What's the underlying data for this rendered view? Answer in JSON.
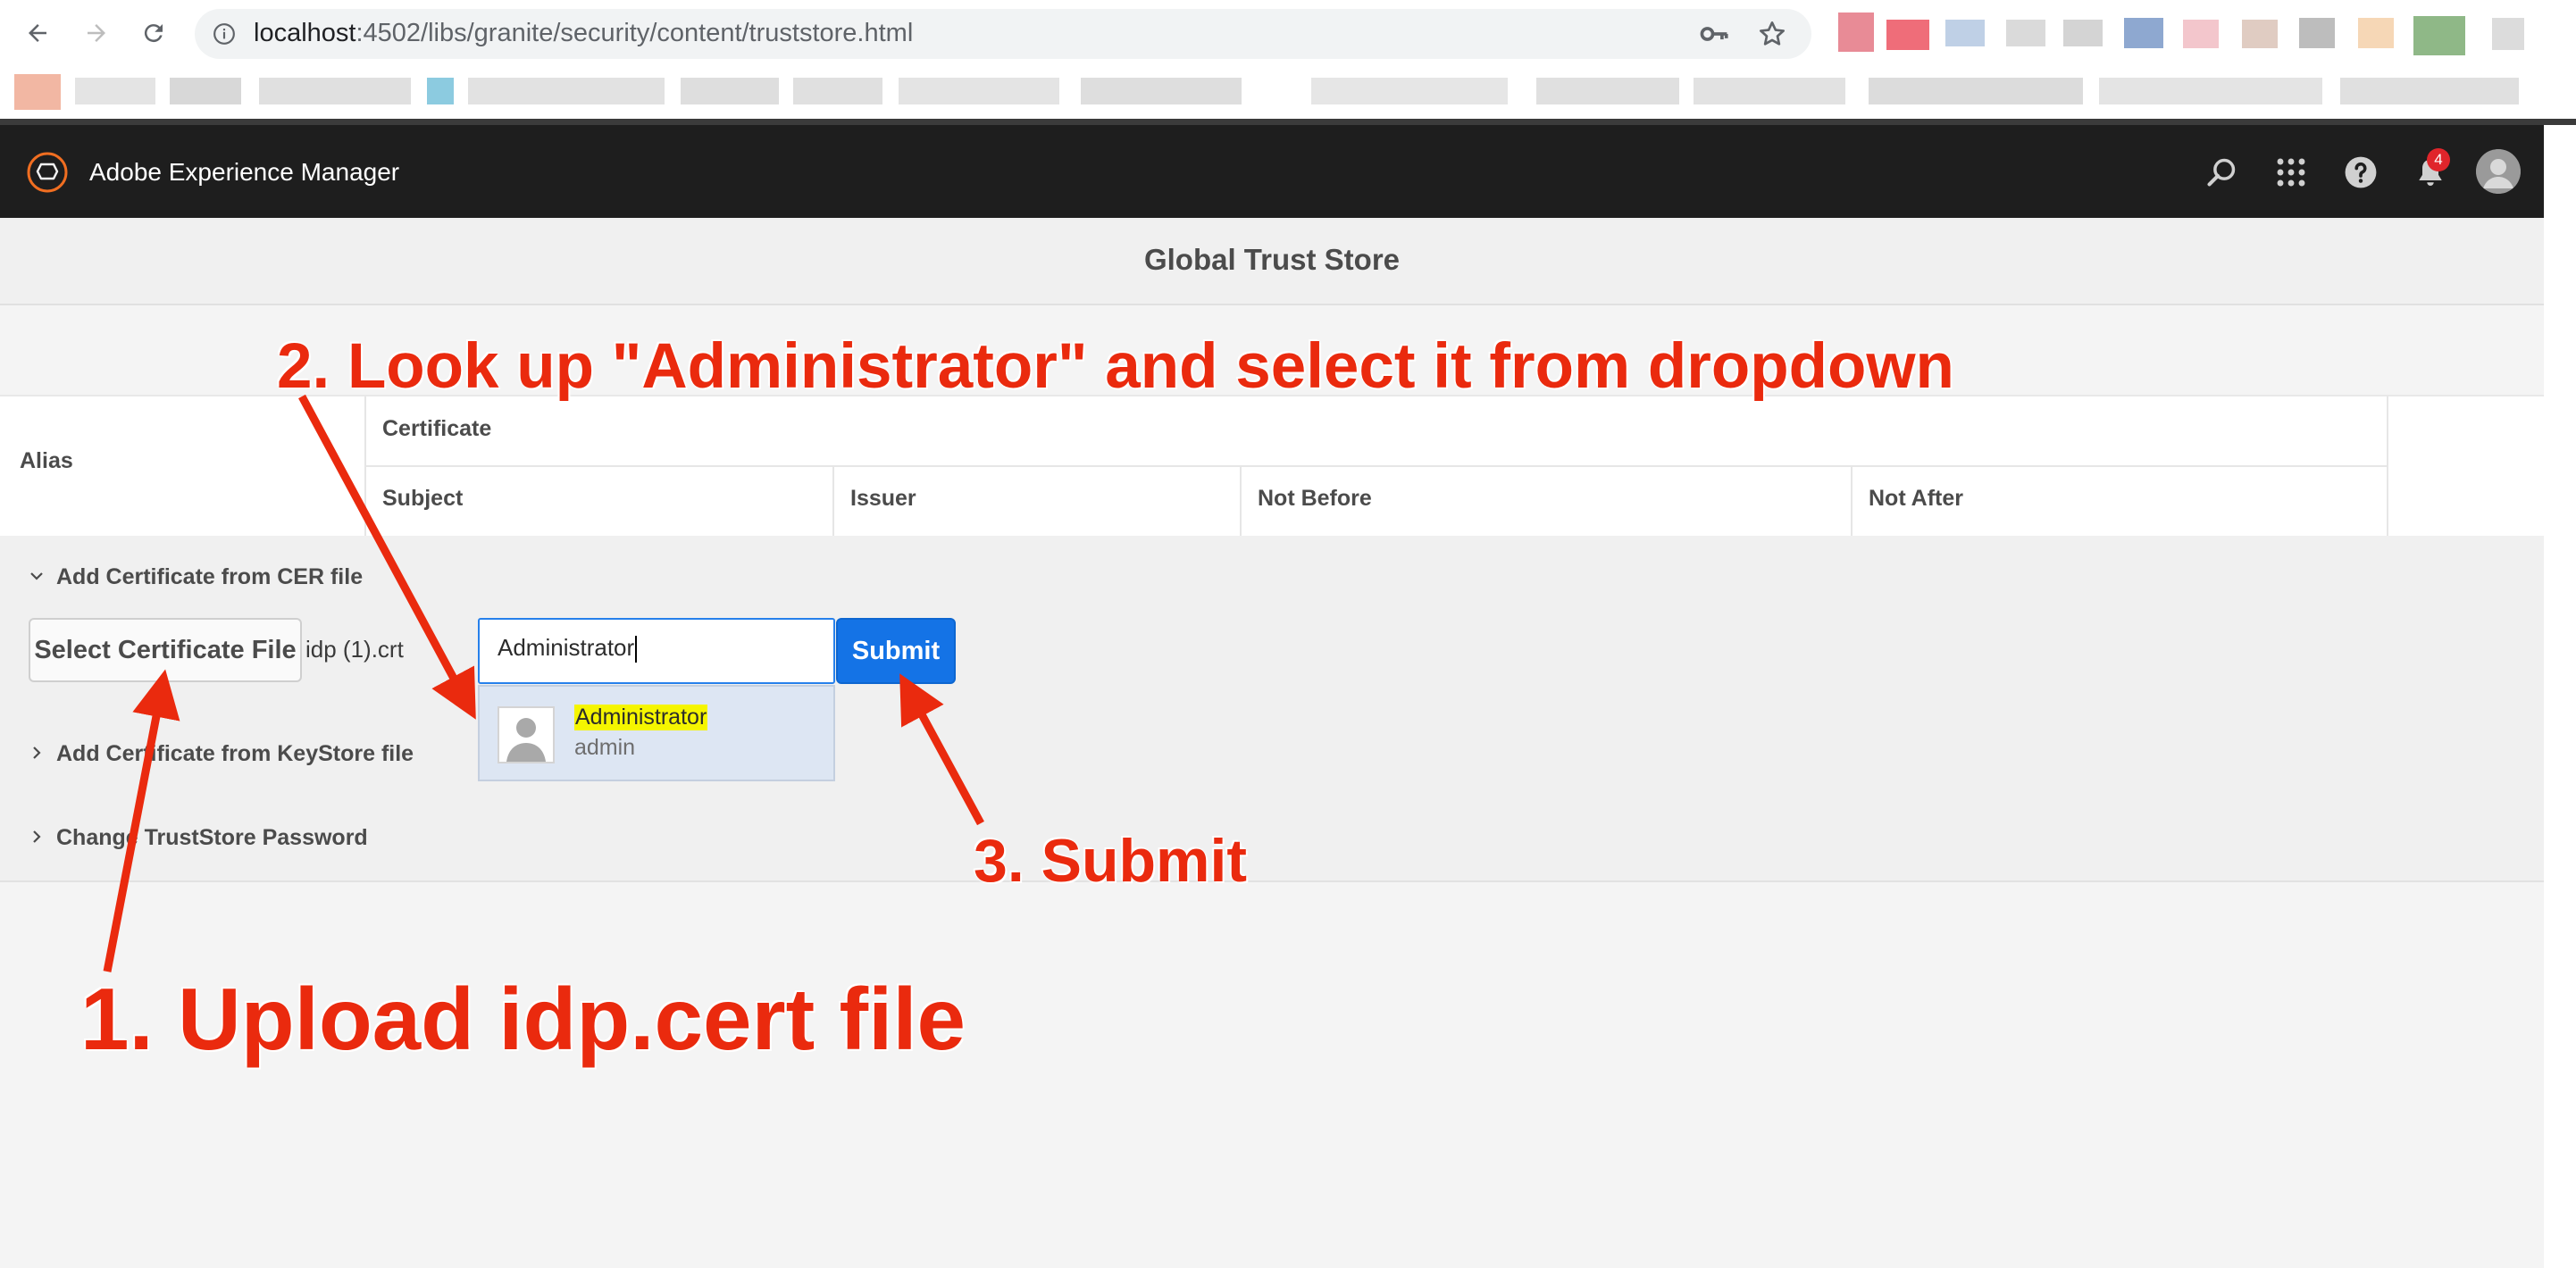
{
  "browser": {
    "url_host": "localhost",
    "url_port": ":4502",
    "url_path": "/libs/granite/security/content/truststore.html"
  },
  "header": {
    "app_title": "Adobe Experience Manager",
    "notification_count": "4"
  },
  "page": {
    "title": "Global Trust Store"
  },
  "table": {
    "alias_header": "Alias",
    "certificate_header": "Certificate",
    "columns": [
      "Subject",
      "Issuer",
      "Not Before",
      "Not After"
    ]
  },
  "sections": {
    "cer": {
      "title": "Add Certificate from CER file",
      "file_button_label": "Select Certificate File",
      "file_name": "idp (1).crt",
      "owner_value": "Administrator",
      "submit_label": "Submit",
      "dropdown": {
        "name": "Administrator",
        "id": "admin"
      }
    },
    "keystore": {
      "title": "Add Certificate from KeyStore file"
    },
    "password": {
      "title": "Change TrustStore Password"
    }
  },
  "annotations": {
    "step1": "1. Upload idp.cert file",
    "step2": "2. Look up \"Administrator\" and select it from dropdown",
    "step3": "3. Submit"
  },
  "colors": {
    "annotation": "#ea2a0e",
    "primary_button": "#1473e6",
    "header_bg": "#1e1e1e",
    "highlight": "#f5f500"
  }
}
